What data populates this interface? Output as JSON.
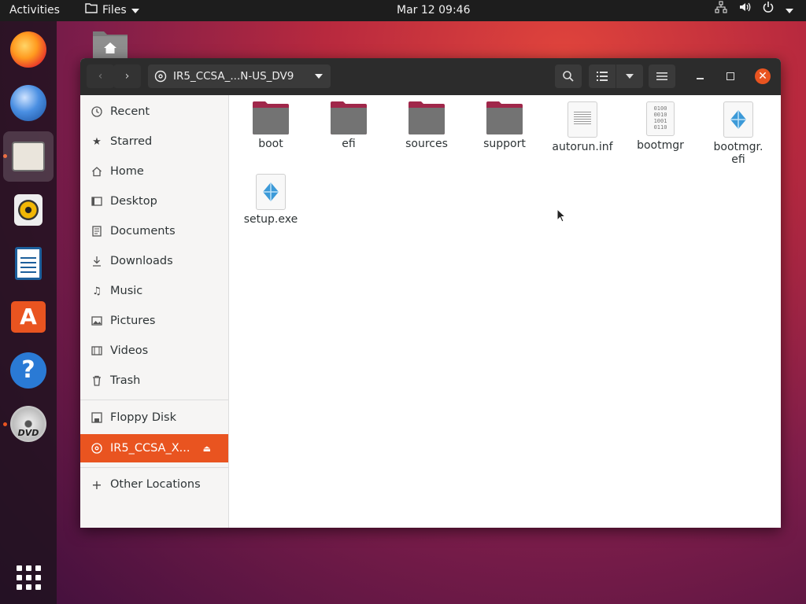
{
  "topbar": {
    "activities": "Activities",
    "app_name": "Files",
    "clock": "Mar 12  09:46"
  },
  "window": {
    "path_label": "IR5_CCSA_...N-US_DV9"
  },
  "sidebar": {
    "items": [
      {
        "label": "Recent",
        "icon": "clock-icon"
      },
      {
        "label": "Starred",
        "icon": "star-icon"
      },
      {
        "label": "Home",
        "icon": "home-icon"
      },
      {
        "label": "Desktop",
        "icon": "desktop-icon"
      },
      {
        "label": "Documents",
        "icon": "document-icon"
      },
      {
        "label": "Downloads",
        "icon": "download-icon"
      },
      {
        "label": "Music",
        "icon": "music-icon"
      },
      {
        "label": "Pictures",
        "icon": "picture-icon"
      },
      {
        "label": "Videos",
        "icon": "film-icon"
      },
      {
        "label": "Trash",
        "icon": "trash-icon"
      },
      {
        "label": "Floppy Disk",
        "icon": "floppy-icon"
      },
      {
        "label": "IR5_CCSA_X...",
        "icon": "disc-icon"
      },
      {
        "label": "Other Locations",
        "icon": "plus-icon"
      }
    ]
  },
  "files": [
    {
      "name": "boot",
      "type": "folder"
    },
    {
      "name": "efi",
      "type": "folder"
    },
    {
      "name": "sources",
      "type": "folder"
    },
    {
      "name": "support",
      "type": "folder"
    },
    {
      "name": "autorun.inf",
      "type": "text"
    },
    {
      "name": "bootmgr",
      "type": "binary"
    },
    {
      "name": "bootmgr.\nefi",
      "type": "executable"
    },
    {
      "name": "setup.exe",
      "type": "executable"
    }
  ],
  "colors": {
    "accent": "#e95420",
    "headerbar": "#2c2c2c",
    "topbar": "#1d1d1d"
  }
}
